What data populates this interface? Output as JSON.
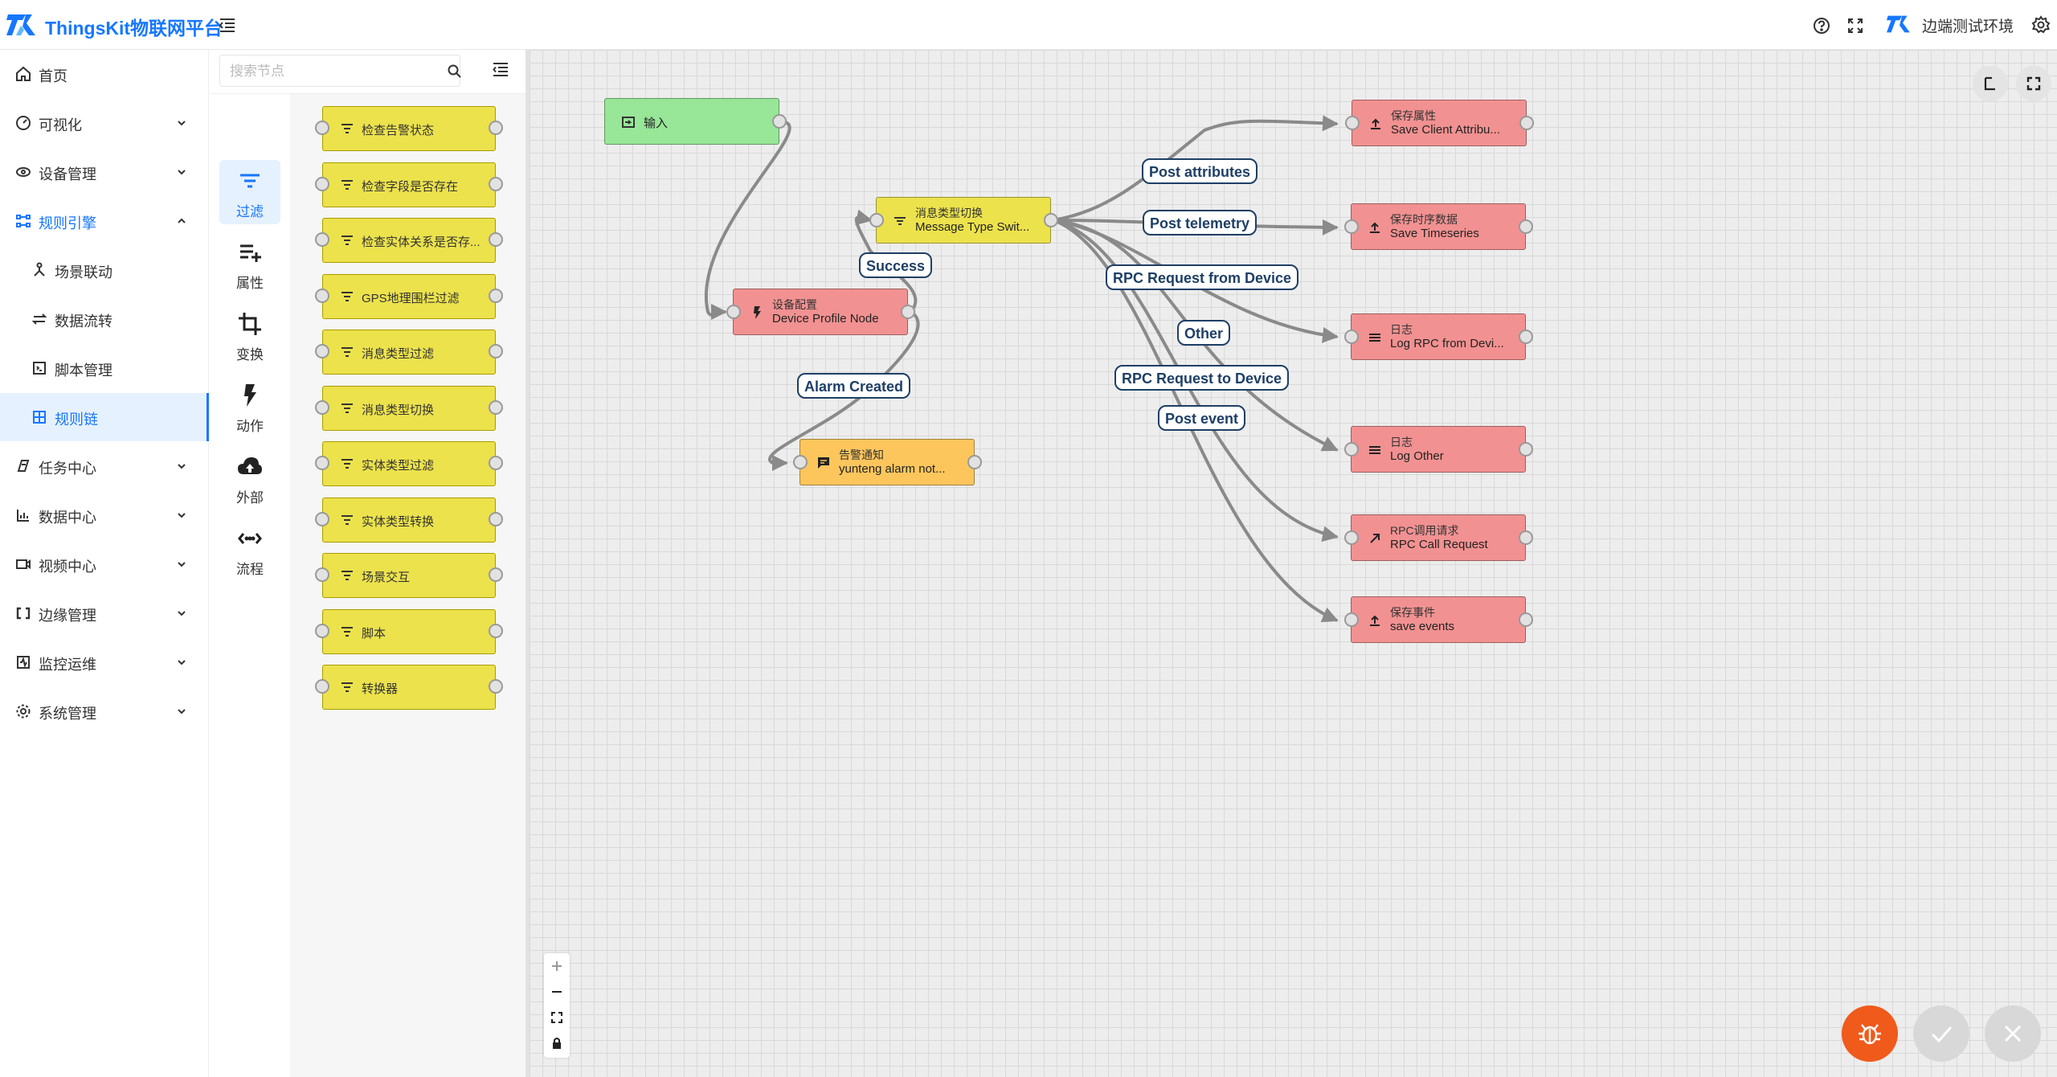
{
  "header": {
    "app_title": "ThingsKit物联网平台",
    "env_name": "边端测试环境",
    "icons": [
      "menu-fold-icon",
      "help-icon",
      "fullscreen-icon",
      "settings-icon"
    ]
  },
  "nav": {
    "items": [
      {
        "label": "首页",
        "icon": "home-icon"
      },
      {
        "label": "可视化",
        "icon": "dashboard-icon"
      },
      {
        "label": "设备管理",
        "icon": "device-icon"
      },
      {
        "label": "规则引擎",
        "icon": "rule-engine-icon"
      },
      {
        "label": "场景联动",
        "icon": "scene-icon"
      },
      {
        "label": "数据流转",
        "icon": "data-flow-icon"
      },
      {
        "label": "脚本管理",
        "icon": "script-icon"
      },
      {
        "label": "规则链",
        "icon": "rule-chain-icon"
      },
      {
        "label": "任务中心",
        "icon": "task-icon"
      },
      {
        "label": "数据中心",
        "icon": "chart-icon"
      },
      {
        "label": "视频中心",
        "icon": "video-icon"
      },
      {
        "label": "边缘管理",
        "icon": "edge-icon"
      },
      {
        "label": "监控运维",
        "icon": "monitor-icon"
      },
      {
        "label": "系统管理",
        "icon": "system-icon"
      }
    ],
    "expanded": "规则引擎",
    "selected": "规则链"
  },
  "palette": {
    "search_placeholder": "搜索节点",
    "search_value": "",
    "categories": [
      {
        "label": "过滤",
        "icon": "filter-icon"
      },
      {
        "label": "属性",
        "icon": "attribute-add-icon"
      },
      {
        "label": "变换",
        "icon": "transform-crop-icon"
      },
      {
        "label": "动作",
        "icon": "action-bolt-icon"
      },
      {
        "label": "外部",
        "icon": "cloud-upload-icon"
      },
      {
        "label": "流程",
        "icon": "flow-code-icon"
      }
    ],
    "active_category": "过滤",
    "nodes": [
      {
        "label": "检查告警状态"
      },
      {
        "label": "检查字段是否存在"
      },
      {
        "label": "检查实体关系是否存..."
      },
      {
        "label": "GPS地理围栏过滤"
      },
      {
        "label": "消息类型过滤"
      },
      {
        "label": "消息类型切换"
      },
      {
        "label": "实体类型过滤"
      },
      {
        "label": "实体类型转换"
      },
      {
        "label": "场景交互"
      },
      {
        "label": "脚本"
      },
      {
        "label": "转换器"
      }
    ]
  },
  "flow": {
    "nodes": {
      "input": {
        "type": "",
        "name": "输入",
        "icon": "input-icon",
        "color": "#98e698"
      },
      "device_profile": {
        "type": "设备配置",
        "name": "Device Profile Node",
        "icon": "bolt-icon",
        "color": "#f29191"
      },
      "switch": {
        "type": "消息类型切换",
        "name": "Message Type Swit...",
        "icon": "filter-icon",
        "color": "#ece24c"
      },
      "alarm": {
        "type": "告警通知",
        "name": "yunteng alarm not...",
        "icon": "message-icon",
        "color": "#fcc65c"
      },
      "save_attr": {
        "type": "保存属性",
        "name": "Save Client Attribu...",
        "icon": "upload-icon",
        "color": "#f29191"
      },
      "save_ts": {
        "type": "保存时序数据",
        "name": "Save Timeseries",
        "icon": "upload-icon",
        "color": "#f29191"
      },
      "log_rpc": {
        "type": "日志",
        "name": "Log RPC from Devi...",
        "icon": "log-icon",
        "color": "#f29191"
      },
      "log_other": {
        "type": "日志",
        "name": "Log Other",
        "icon": "log-icon",
        "color": "#f29191"
      },
      "rpc_call": {
        "type": "RPC调用请求",
        "name": "RPC Call Request",
        "icon": "arrow-up-right-icon",
        "color": "#f29191"
      },
      "save_events": {
        "type": "保存事件",
        "name": "save events",
        "icon": "upload-icon",
        "color": "#f29191"
      }
    },
    "edge_labels": {
      "success": "Success",
      "alarm_created": "Alarm Created",
      "post_attributes": "Post attributes",
      "post_telemetry": "Post telemetry",
      "rpc_from_device": "RPC Request from Device",
      "other": "Other",
      "rpc_to_device": "RPC Request to Device",
      "post_event": "Post event"
    }
  },
  "controls": {
    "zoom": [
      "zoom-in-icon",
      "zoom-out-icon",
      "fit-view-icon",
      "lock-icon"
    ],
    "fab": {
      "debug_color": "#f05a1a",
      "idle_color": "#d8d8d8"
    }
  }
}
